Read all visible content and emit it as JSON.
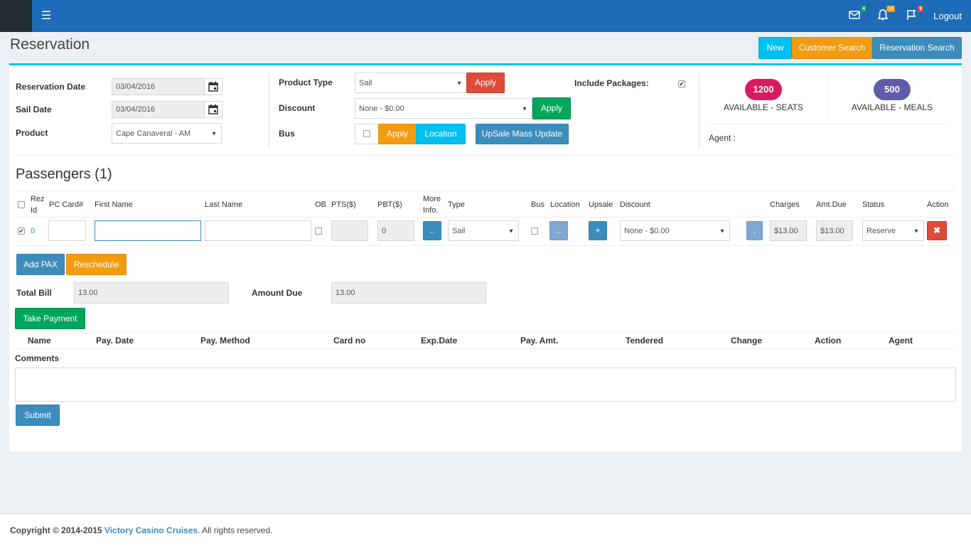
{
  "header": {
    "logout_label": "Logout",
    "mail_count": "4",
    "notif_count": "10",
    "flag_count": "9"
  },
  "page": {
    "title": "Reservation",
    "new_label": "New",
    "customer_search_label": "Customer Search",
    "reservation_search_label": "Reservation Search"
  },
  "form": {
    "reservation_date_label": "Reservation Date",
    "reservation_date_value": "03/04/2016",
    "sail_date_label": "Sail Date",
    "sail_date_value": "03/04/2016",
    "product_label": "Product",
    "product_value": "Cape Canaveral - AM",
    "product_type_label": "Product Type",
    "product_type_value": "Sail",
    "apply_label": "Apply",
    "discount_label": "Discount",
    "discount_value": "None - $0.00",
    "bus_label": "Bus",
    "location_label": "Location",
    "upsale_mass_update_label": "UpSale Mass Update",
    "include_packages_label": "Include Packages:",
    "seats_count": "1200",
    "seats_label": "AVAILABLE - SEATS",
    "meals_count": "500",
    "meals_label": "AVAILABLE - MEALS",
    "agent_label": "Agent :"
  },
  "passengers": {
    "title": "Passengers (1)",
    "columns": [
      "Rez Id",
      "PC Card#",
      "First Name",
      "Last Name",
      "OB",
      "PTS($)",
      "PBT($)",
      "More Info.",
      "Type",
      "Bus",
      "Location",
      "Upsale",
      "Discount",
      "Charges",
      "Amt.Due",
      "Status",
      "Action"
    ],
    "row": {
      "rez_id": "0",
      "pbt": "0",
      "more_info": "..",
      "type": "Sail",
      "location_btn": "..",
      "upsale_btn": "+",
      "discount": "None - $0.00",
      "dot_btn": ".",
      "charges": "$13.00",
      "amt_due": "$13.00",
      "status": "Reserve"
    },
    "add_pax_label": "Add PAX",
    "reschedule_label": "Reschedule"
  },
  "billing": {
    "total_bill_label": "Total Bill",
    "total_bill_value": "13.00",
    "amount_due_label": "Amount Due",
    "amount_due_value": "13.00",
    "take_payment_label": "Take Payment",
    "columns": [
      "Name",
      "Pay. Date",
      "Pay. Method",
      "Card no",
      "Exp.Date",
      "Pay. Amt.",
      "Tendered",
      "Change",
      "Action",
      "Agent"
    ],
    "comments_label": "Comments",
    "submit_label": "Submit"
  },
  "footer": {
    "copyright": "Copyright © 2014-2015",
    "company": "Victory Casino Cruises",
    "rights": ". All rights reserved."
  }
}
